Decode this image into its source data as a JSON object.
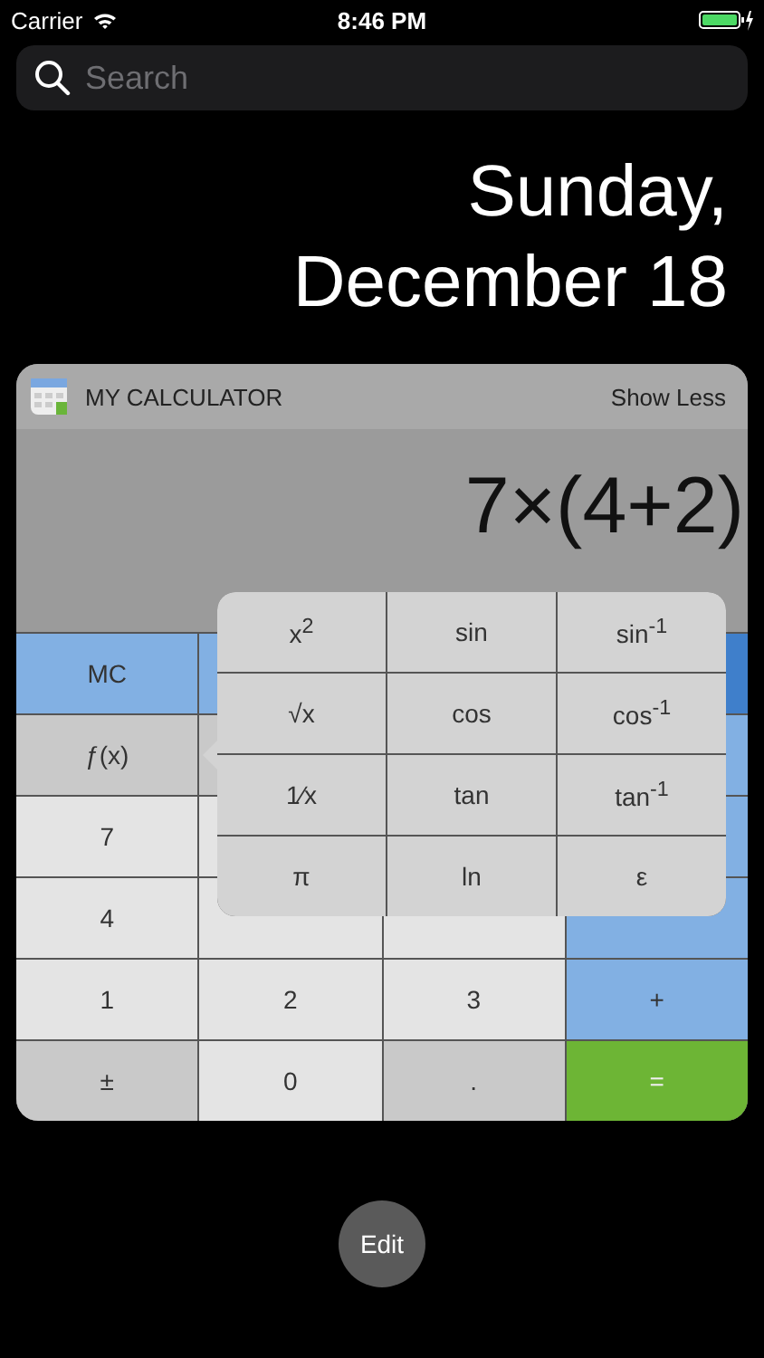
{
  "status_bar": {
    "carrier": "Carrier",
    "time": "8:46 PM"
  },
  "search": {
    "placeholder": "Search"
  },
  "date": {
    "weekday": "Sunday,",
    "day": "December 18"
  },
  "widget": {
    "title": "MY CALCULATOR",
    "action": "Show Less",
    "expression": "7×(4+2)",
    "keys": [
      {
        "label": "MC",
        "kind": "memory"
      },
      {
        "kind": "memory"
      },
      {
        "kind": "covered"
      },
      {
        "kind": "memory_active"
      },
      {
        "label": "ƒ(x)",
        "kind": "function"
      },
      {
        "kind": "function"
      },
      {
        "kind": "covered"
      },
      {
        "kind": "operator"
      },
      {
        "label": "7",
        "kind": "digit"
      },
      {
        "kind": "digit"
      },
      {
        "kind": "covered"
      },
      {
        "kind": "operator"
      },
      {
        "label": "4",
        "kind": "digit"
      },
      {
        "kind": "digit"
      },
      {
        "kind": "digit"
      },
      {
        "kind": "operator"
      },
      {
        "label": "1",
        "kind": "digit"
      },
      {
        "label": "2",
        "kind": "digit"
      },
      {
        "label": "3",
        "kind": "digit"
      },
      {
        "label": "+",
        "kind": "operator"
      },
      {
        "label": "±",
        "kind": "function"
      },
      {
        "label": "0",
        "kind": "digit"
      },
      {
        "label": ".",
        "kind": "function"
      },
      {
        "label": "=",
        "kind": "equals"
      }
    ],
    "popup": [
      "x$^{2}$",
      "sin",
      "sin$^{-1}$",
      "√x",
      "cos",
      "cos$^{-1}$",
      "1⁄x",
      "tan",
      "tan$^{-1}$",
      "π",
      "ln",
      "ε"
    ]
  },
  "edit_button": "Edit"
}
